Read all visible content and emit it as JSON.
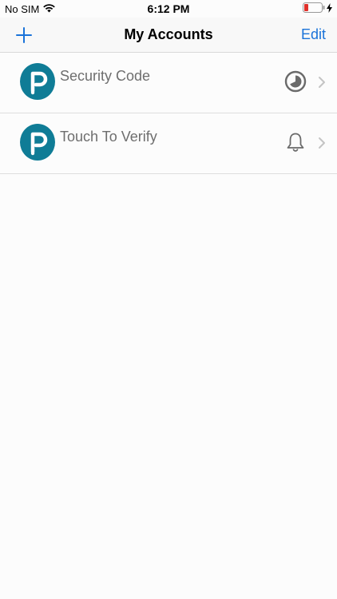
{
  "status_bar": {
    "carrier": "No SIM",
    "time": "6:12 PM"
  },
  "nav": {
    "title": "My Accounts",
    "edit_label": "Edit",
    "add_icon": "plus-icon",
    "accent_color": "#1a73d9"
  },
  "accounts": [
    {
      "label": "Security Code",
      "logo_letter": "P",
      "status_icon": "timer-icon",
      "chevron": "chevron-right-icon"
    },
    {
      "label": "Touch To Verify",
      "logo_letter": "P",
      "status_icon": "bell-icon",
      "chevron": "chevron-right-icon"
    }
  ],
  "colors": {
    "brand": "#0f7c96",
    "label": "#6e6e6e",
    "icon": "#6a6a6a",
    "battery_low": "#e0302a"
  }
}
